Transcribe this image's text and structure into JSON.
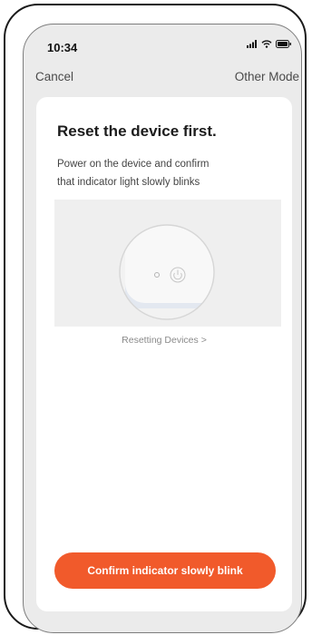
{
  "status_bar": {
    "time": "10:34",
    "icons": [
      "signal-icon",
      "wifi-icon",
      "battery-icon"
    ]
  },
  "nav": {
    "cancel_label": "Cancel",
    "other_mode_label": "Other Mode"
  },
  "content": {
    "title": "Reset the device first.",
    "description_lines": [
      "Power on the device and confirm",
      "that indicator light slowly blinks"
    ],
    "illustration_icon": "device-indicator-icon",
    "reset_link": "Resetting Devices >",
    "confirm_button": "Confirm indicator slowly blink"
  },
  "colors": {
    "accent": "#f15a2b",
    "background": "#ebebeb",
    "card": "#ffffff"
  }
}
